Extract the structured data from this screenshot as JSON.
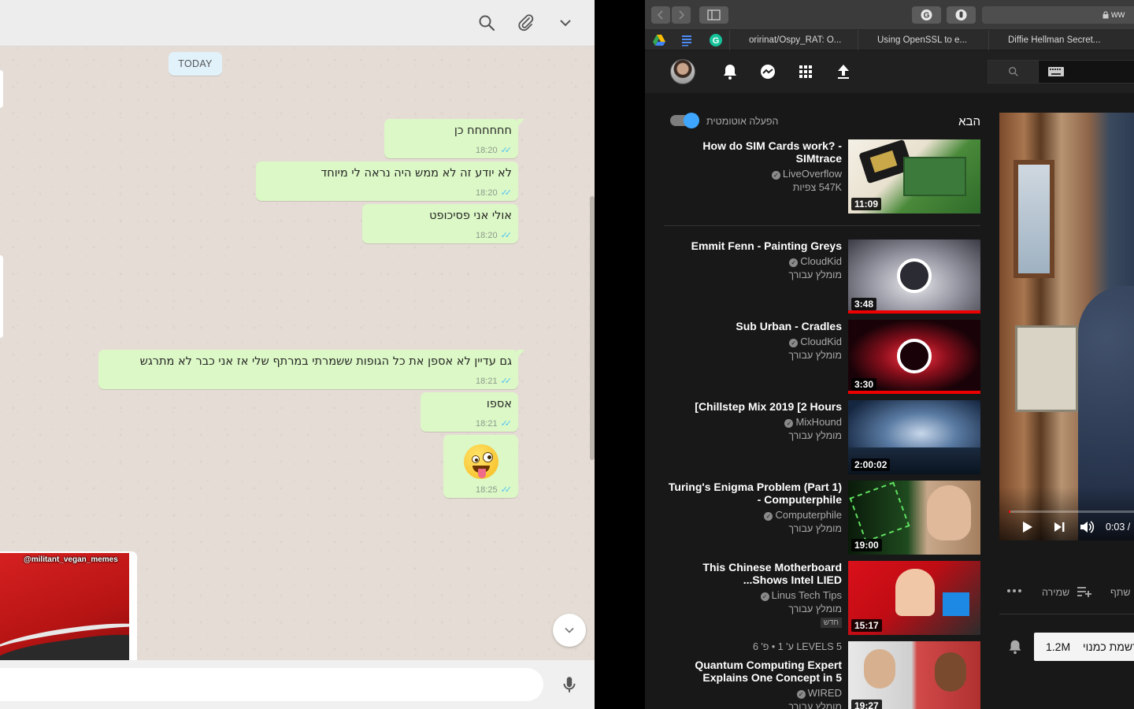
{
  "whatsapp": {
    "header_icons": [
      "search-icon",
      "paperclip-icon",
      "chevron-down-icon"
    ],
    "date_divider": "TODAY",
    "messages": [
      {
        "text": "חחחחחח כן",
        "time": "18:20"
      },
      {
        "text": "לא יודע זה לא ממש היה נראה לי מיוחד",
        "time": "18:20"
      },
      {
        "text": "אולי אני פסיכופט",
        "time": "18:20"
      },
      {
        "text": "גם עדיין לא אספן את כל הגופות ששמרתי במרתף שלי אז אני כבר לא מתרגש",
        "time": "18:21"
      },
      {
        "text": "אספו",
        "time": "18:21"
      },
      {
        "text": "",
        "emoji": "zany-face-emoji",
        "time": "18:25"
      }
    ],
    "incoming_image_caption": "@militant_vegan_memes",
    "read_ticks": "✓✓",
    "colors": {
      "outgoing_bubble": "#dcf8c6",
      "background": "#e5ddd5",
      "tick": "#4fc3f7"
    }
  },
  "browser": {
    "tabs": [
      {
        "title": "oririnat/Ospy_RAT: O..."
      },
      {
        "title": "Using OpenSSL to e..."
      },
      {
        "title": "Diffie Hellman Secret..."
      }
    ],
    "address_fragment": "ww"
  },
  "youtube": {
    "up_next_label": "הבא",
    "autoplay_label": "הפעלה אוטומטית",
    "autoplay_on": true,
    "videos": [
      {
        "title": "How do SIM Cards work? - SIMtrace",
        "channel": "LiveOverflow",
        "meta": "547K צפיות",
        "duration": "11:09",
        "badge": ""
      },
      {
        "title": "Emmit Fenn - Painting Greys",
        "channel": "CloudKid",
        "meta": "מומלץ עבורך",
        "duration": "3:48",
        "badge": ""
      },
      {
        "title": "Sub Urban - Cradles",
        "channel": "CloudKid",
        "meta": "מומלץ עבורך",
        "duration": "3:30",
        "badge": ""
      },
      {
        "title": "[Chillstep Mix 2019 [2 Hours",
        "channel": "MixHound",
        "meta": "מומלץ עבורך",
        "duration": "2:00:02",
        "badge": ""
      },
      {
        "title": "Turing's Enigma Problem (Part 1) - Computerphile",
        "channel": "Computerphile",
        "meta": "מומלץ עבורך",
        "duration": "19:00",
        "badge": ""
      },
      {
        "title": "This Chinese Motherboard ...Shows Intel LIED",
        "channel": "Linus Tech Tips",
        "meta": "מומלץ עבורך",
        "duration": "15:17",
        "badge": "חדש"
      },
      {
        "title": "Quantum Computing Expert Explains One Concept in 5",
        "channel": "WIRED",
        "meta": "מומלץ עבורך",
        "duration": "19:27",
        "badge": "",
        "playlist_label": "LEVELS 5 ע' 1 • פ' 6"
      }
    ],
    "player": {
      "time": "0:03 /",
      "progress_fraction": 0.01
    },
    "actions": {
      "save": "שמירה",
      "share": "שתף"
    },
    "subscribe": {
      "label": "רשמת כמנוי",
      "count": "1.2M"
    }
  }
}
